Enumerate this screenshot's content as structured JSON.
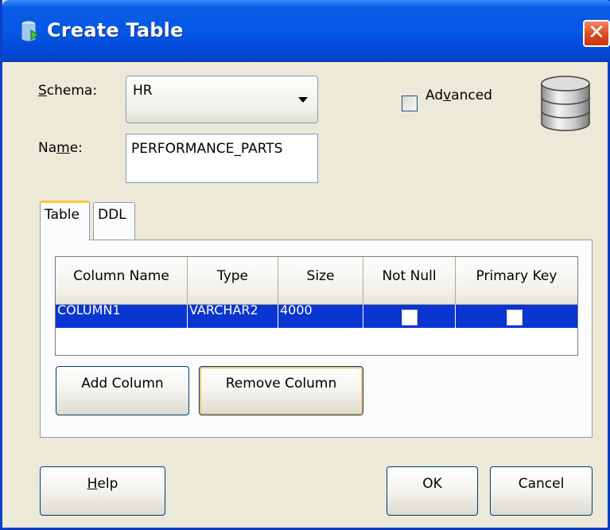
{
  "window": {
    "title": "Create Table",
    "close_glyph": "✕"
  },
  "schema": {
    "label_hot": "S",
    "label_rest": "chema:",
    "value": "HR"
  },
  "name": {
    "label_pre": "Na",
    "label_hot": "m",
    "label_rest": "e:",
    "value": "PERFORMANCE_PARTS"
  },
  "advanced": {
    "label_pre": "Ad",
    "label_hot": "v",
    "label_rest": "anced",
    "checked": false
  },
  "tabs": [
    {
      "label": "Table",
      "active": true
    },
    {
      "label": "DDL",
      "active": false
    }
  ],
  "columns_table": {
    "headers": [
      "Column Name",
      "Type",
      "Size",
      "Not Null",
      "Primary Key"
    ],
    "rows": [
      {
        "column_name": "COLUMN1",
        "type": "VARCHAR2",
        "size": "4000",
        "not_null": false,
        "primary_key": false
      }
    ],
    "selection_color": "#0a35d0"
  },
  "buttons": {
    "add_column": "Add Column",
    "remove_column": "Remove Column",
    "help_hot": "H",
    "help_rest": "elp",
    "ok": "OK",
    "cancel": "Cancel"
  },
  "colors": {
    "titlebar": "#0558e6",
    "dialog_bg": "#ece9d8",
    "focus_ring": "#f6c569",
    "close": "#d8461e"
  }
}
